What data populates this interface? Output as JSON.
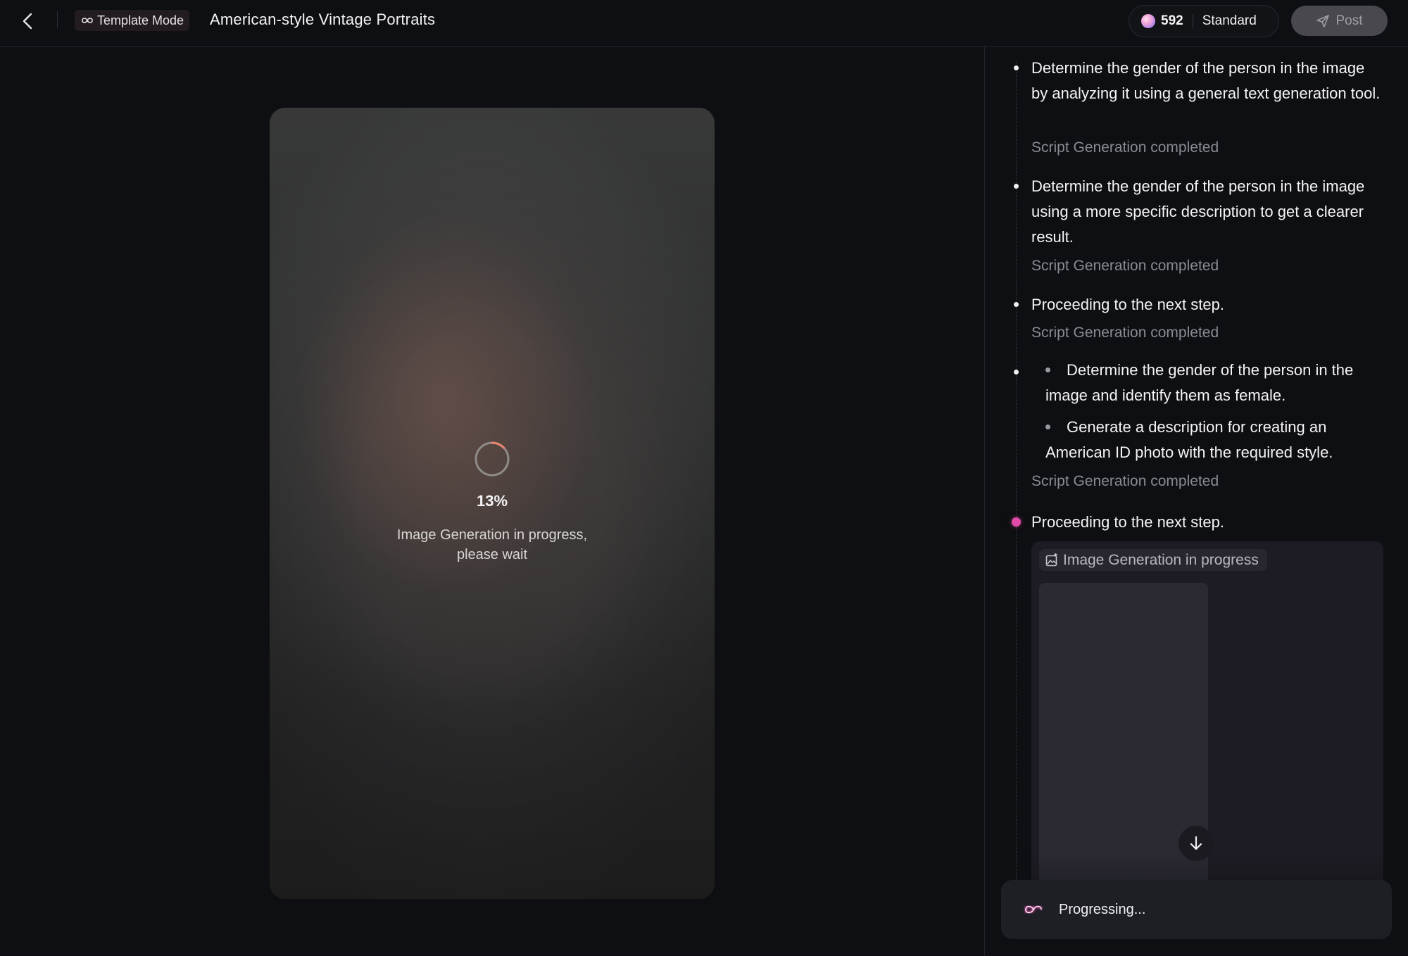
{
  "header": {
    "mode_label": "Template Mode",
    "title": "American-style Vintage Portraits",
    "credits": "592",
    "quality": "Standard",
    "post_label": "Post"
  },
  "icons": {
    "back": "chevron-left-icon",
    "mode": "infinity-icon",
    "credits": "gem-icon",
    "post": "send-icon",
    "loader": "spinner-icon",
    "image_gen": "image-edit-icon",
    "scroll": "arrow-down-icon",
    "progress": "infinity-glow-icon"
  },
  "preview": {
    "percent": "13%",
    "message": "Image Generation in progress, please wait",
    "progress_fraction": 0.13
  },
  "steps": [
    {
      "text": "Determine the gender of the person in the image by analyzing it using a general text generation tool.",
      "status": "Script Generation completed"
    },
    {
      "text": "Determine the gender of the person in the image using a more specific description to get a clearer result.",
      "status": "Script Generation completed"
    },
    {
      "text": "Proceeding to the next step.",
      "status": "Script Generation completed"
    },
    {
      "sub_items": [
        "Determine the gender of the person in the image and identify them as female.",
        "Generate a description for creating an American ID photo with the required style."
      ],
      "status": "Script Generation completed"
    },
    {
      "text": "Proceeding to the next step.",
      "active": true,
      "chip_label": "Image Generation in progress"
    }
  ],
  "footer": {
    "progress_label": "Progressing..."
  },
  "colors": {
    "background": "#0e0f12",
    "accent": "#e14aa8",
    "spinner_arc": "#e8866f"
  }
}
